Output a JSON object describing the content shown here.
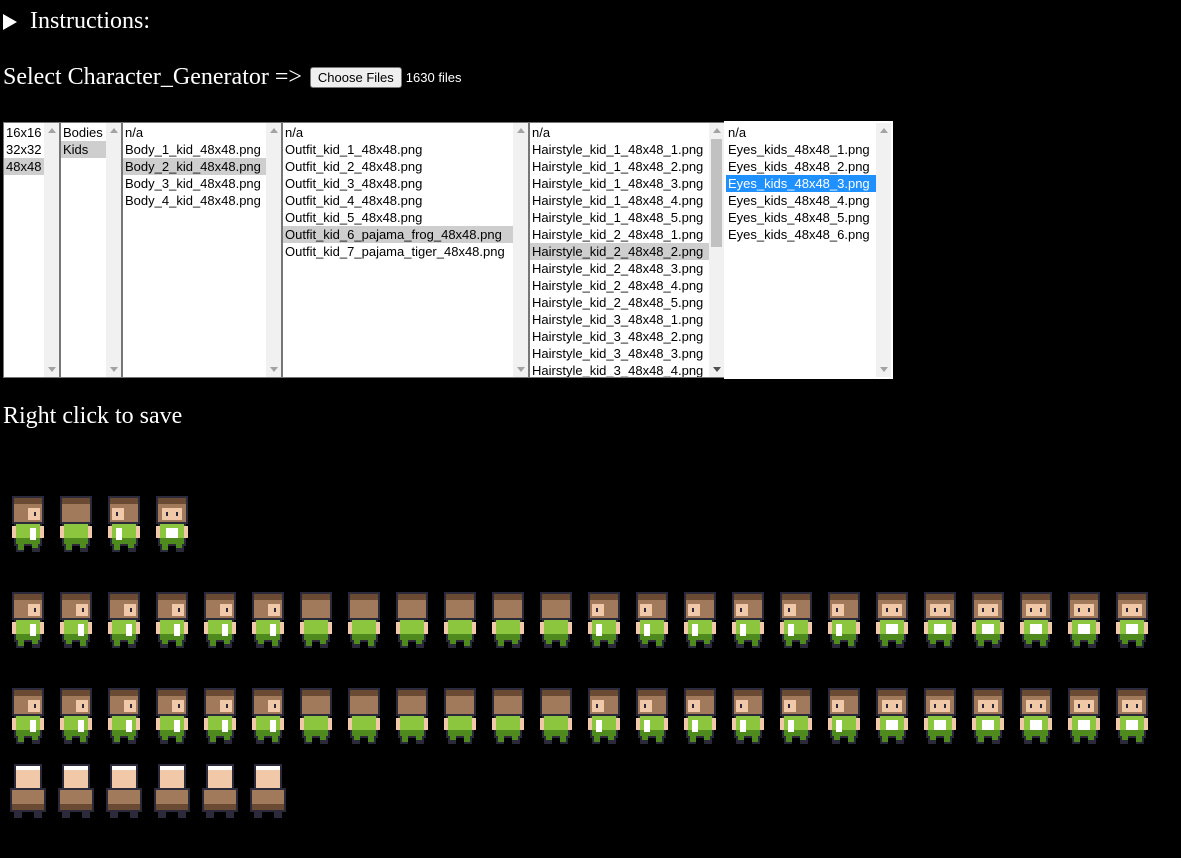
{
  "instructions": {
    "label": "Instructions:"
  },
  "select_row": {
    "label": "Select Character_Generator =>",
    "button": "Choose Files",
    "file_count": "1630 files"
  },
  "lists": {
    "size": [
      "16x16",
      "32x32",
      "48x48"
    ],
    "category": [
      "Bodies",
      "Kids"
    ],
    "body": [
      "n/a",
      "Body_1_kid_48x48.png",
      "Body_2_kid_48x48.png",
      "Body_3_kid_48x48.png",
      "Body_4_kid_48x48.png"
    ],
    "outfit": [
      "n/a",
      "Outfit_kid_1_48x48.png",
      "Outfit_kid_2_48x48.png",
      "Outfit_kid_3_48x48.png",
      "Outfit_kid_4_48x48.png",
      "Outfit_kid_5_48x48.png",
      "Outfit_kid_6_pajama_frog_48x48.png",
      "Outfit_kid_7_pajama_tiger_48x48.png"
    ],
    "hairstyle": [
      "n/a",
      "Hairstyle_kid_1_48x48_1.png",
      "Hairstyle_kid_1_48x48_2.png",
      "Hairstyle_kid_1_48x48_3.png",
      "Hairstyle_kid_1_48x48_4.png",
      "Hairstyle_kid_1_48x48_5.png",
      "Hairstyle_kid_2_48x48_1.png",
      "Hairstyle_kid_2_48x48_2.png",
      "Hairstyle_kid_2_48x48_3.png",
      "Hairstyle_kid_2_48x48_4.png",
      "Hairstyle_kid_2_48x48_5.png",
      "Hairstyle_kid_3_48x48_1.png",
      "Hairstyle_kid_3_48x48_2.png",
      "Hairstyle_kid_3_48x48_3.png",
      "Hairstyle_kid_3_48x48_4.png"
    ],
    "eyes": [
      "n/a",
      "Eyes_kids_48x48_1.png",
      "Eyes_kids_48x48_2.png",
      "Eyes_kids_48x48_3.png",
      "Eyes_kids_48x48_4.png",
      "Eyes_kids_48x48_5.png",
      "Eyes_kids_48x48_6.png"
    ]
  },
  "selected": {
    "size": "48x48",
    "category": "Kids",
    "body": "Body_2_kid_48x48.png",
    "outfit": "Outfit_kid_6_pajama_frog_48x48.png",
    "hairstyle": "Hairstyle_kid_2_48x48_2.png",
    "eyes": "Eyes_kids_48x48_3.png"
  },
  "save_hint": "Right click to save",
  "colors": {
    "background": "#000000",
    "hair": "#a07a5a",
    "hair_dark": "#6b4a33",
    "outfit": "#8cc63f",
    "outfit_dark": "#4f8a1f",
    "skin": "#f2c9a8",
    "outline": "#2a2a3a",
    "selection_blue": "#1e90ff"
  },
  "sprite_sheet": {
    "row1": [
      "right",
      "back",
      "left",
      "front"
    ],
    "row2_count": 24,
    "row3_count": 24,
    "row4_count": 6
  }
}
